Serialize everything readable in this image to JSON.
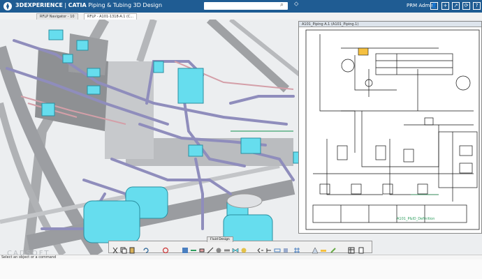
{
  "app": {
    "brand": "3DEXPERIENCE",
    "separator": "|",
    "product": "CATIA",
    "module": "Piping & Tubing 3D Design",
    "user": "PRM Admin"
  },
  "tabs": [
    {
      "label": "RFLP Navigator - 10",
      "active": false
    },
    {
      "label": "RFLP - A101-1318-A.1 (C...",
      "active": true
    }
  ],
  "schematic": {
    "title": "A101_Piping A.1 (A101_Piping.1)",
    "caption": "A101_P&ID_Definition"
  },
  "toolbar": {
    "label": "Fluid Design"
  },
  "status": {
    "hint": "Select an object or a command"
  },
  "watermark": "CADSOFT",
  "colors": {
    "header": "#1f5c93",
    "pipe": "#8f8dbc",
    "component": "#66ddee",
    "structure": "#a8aaad"
  }
}
